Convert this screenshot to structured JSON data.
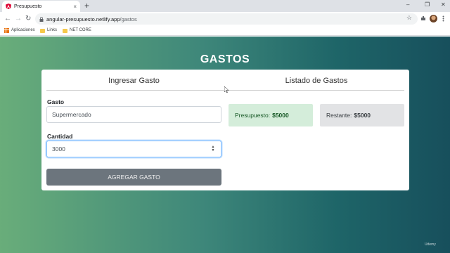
{
  "browser": {
    "tab_title": "Presupuesto",
    "tab_close": "×",
    "new_tab": "+",
    "url_host": "angular-presupuesto.netlify.app",
    "url_path": "/gastos",
    "bookmarks": [
      "Aplicaciones",
      "Links",
      "NET CORE"
    ],
    "window_controls": [
      "–",
      "❐",
      "✕"
    ]
  },
  "page": {
    "title": "GASTOS"
  },
  "ingresar": {
    "heading": "Ingresar Gasto",
    "gasto_label": "Gasto",
    "gasto_value": "Supermercado",
    "cantidad_label": "Cantidad",
    "cantidad_value": "3000",
    "button_label": "AGREGAR GASTO"
  },
  "listado": {
    "heading": "Listado de Gastos",
    "presupuesto_label": "Presupuesto:",
    "presupuesto_value": "$5000",
    "restante_label": "Restante:",
    "restante_value": "$5000"
  },
  "watermark": "Udemy",
  "colors": {
    "gradient_start": "#69ad7a",
    "gradient_end": "#174f5c",
    "button": "#6c757d",
    "success_bg": "#d4edda",
    "secondary_bg": "#e2e3e5"
  }
}
